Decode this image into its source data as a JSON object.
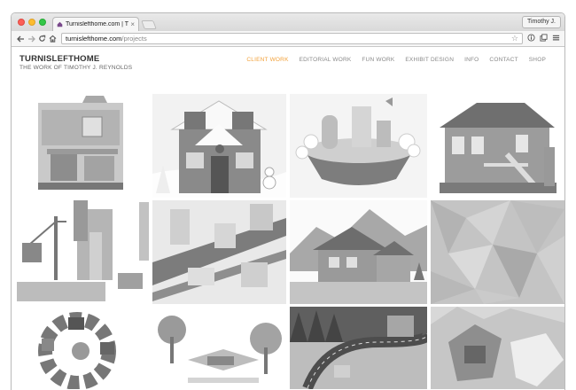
{
  "browser": {
    "tab_title": "Turnislefthome.com | The W",
    "tab_close": "×",
    "profile_name": "Timothy J.",
    "url_host": "turnislefthome.com",
    "url_path": "/projects",
    "back_icon": "arrow-left-icon",
    "forward_icon": "arrow-right-icon",
    "reload_icon": "reload-icon",
    "home_icon": "home-icon"
  },
  "site": {
    "brand": "TURNISLEFTHOME",
    "tagline": "THE WORK OF TIMOTHY J. REYNOLDS",
    "accent_color": "#f2a13a"
  },
  "nav": {
    "items": [
      {
        "label": "CLIENT WORK",
        "active": true
      },
      {
        "label": "EDITORIAL WORK",
        "active": false
      },
      {
        "label": "FUN WORK",
        "active": false
      },
      {
        "label": "EXHIBIT DESIGN",
        "active": false
      },
      {
        "label": "INFO",
        "active": false
      },
      {
        "label": "CONTACT",
        "active": false
      },
      {
        "label": "SHOP",
        "active": false
      }
    ]
  }
}
